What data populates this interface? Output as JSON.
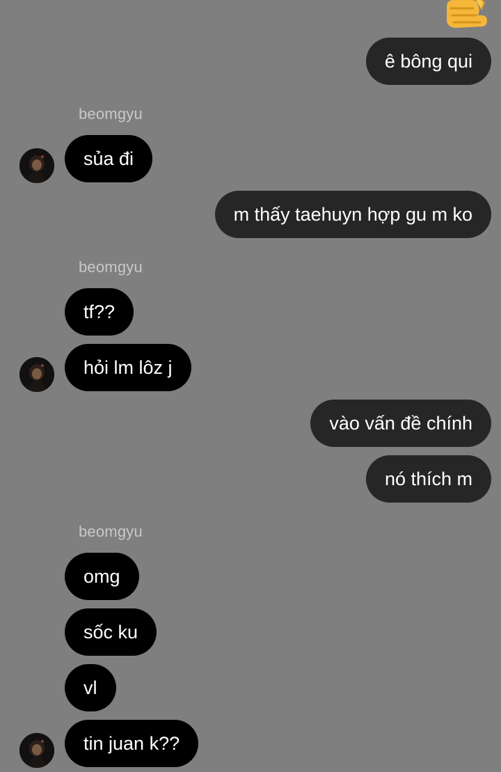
{
  "chat": {
    "reaction_icon": "thumbs-up-emoji",
    "colors": {
      "background": "#7f7f7f",
      "sent_bubble": "#262626",
      "received_bubble": "#000000",
      "sender_name": "#c8c8c8"
    },
    "messages": {
      "m1": "ê bông qui",
      "m2_sender": "beomgyu",
      "m2": "sủa đi",
      "m3": "m thấy taehuyn hợp gu m ko",
      "m4_sender": "beomgyu",
      "m4a": "tf??",
      "m4b": "hỏi lm lôz j",
      "m5a": "vào vấn đề chính",
      "m5b": "nó thích m",
      "m6_sender": "beomgyu",
      "m6a": "omg",
      "m6b": "sốc ku",
      "m6c": "vl",
      "m6d": "tin juan k??"
    }
  }
}
